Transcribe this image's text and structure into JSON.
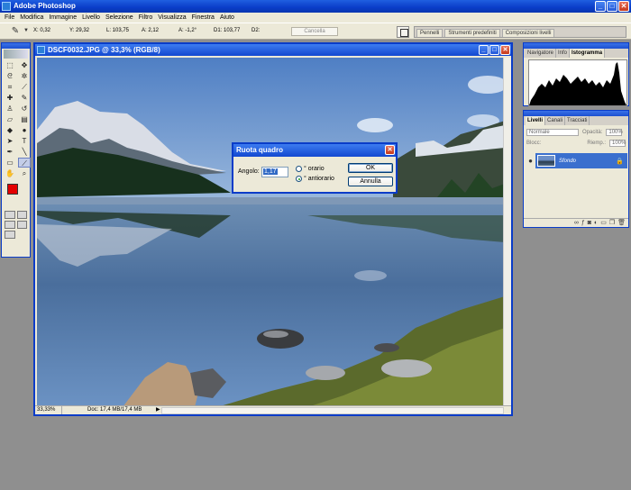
{
  "app": {
    "title": "Adobe Photoshop",
    "minimize": "_",
    "maximize": "□",
    "close": "✕"
  },
  "menu": [
    "File",
    "Modifica",
    "Immagine",
    "Livello",
    "Selezione",
    "Filtro",
    "Visualizza",
    "Finestra",
    "Aiuto"
  ],
  "options": {
    "x": "X:  0,32",
    "y": "Y:  29,32",
    "l": "L:  103,75",
    "a": "A:  2,12",
    "angle": "A:  -1,2°",
    "d1": "D1:  103,77",
    "d2": "D2:",
    "cancel": "Cancella"
  },
  "well_tabs": [
    "Pennelli",
    "Strumenti predefiniti",
    "Composizioni livelli"
  ],
  "document": {
    "title": "DSCF0032.JPG @ 33,3% (RGB/8)",
    "zoom": "33,33%",
    "doc_info": "Doc: 17,4 MB/17,4 MB",
    "status_arrow": "▶"
  },
  "dialog": {
    "title": "Ruota quadro",
    "angle_label": "Angolo:",
    "angle_value": "1,17",
    "option_cw": "° orario",
    "option_ccw": "° antiorario",
    "ok": "OK",
    "cancel": "Annulla"
  },
  "panel_histogram": {
    "tabs": [
      "Navigatore",
      "Info",
      "Istogramma"
    ]
  },
  "panel_layers": {
    "tabs": [
      "Livelli",
      "Canali",
      "Tracciati"
    ],
    "blend_mode": "Normale",
    "opacity_label": "Opacità:",
    "opacity_value": "100%",
    "lock_label": "Blocc:",
    "fill_label": "Riemp.:",
    "fill_value": "100%",
    "layer_name": "Sfondo",
    "eye": "●",
    "lock_icon": "🔒"
  }
}
